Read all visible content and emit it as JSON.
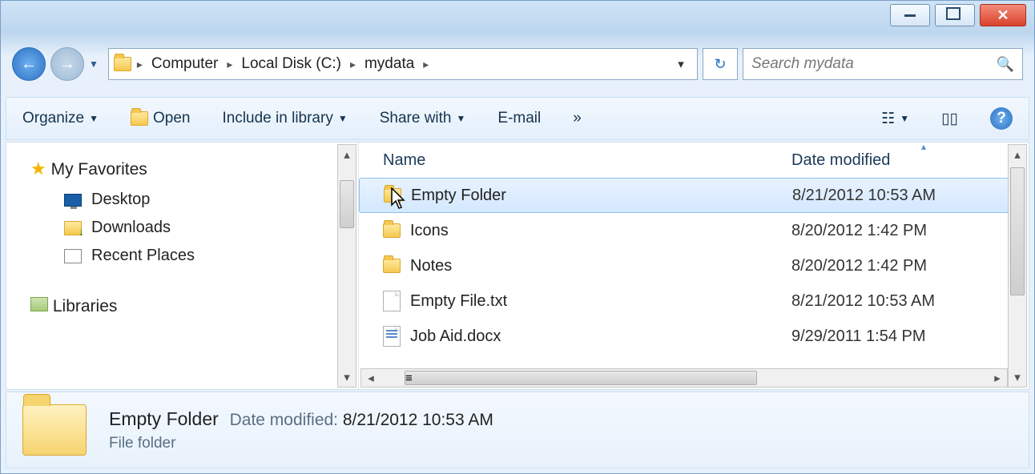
{
  "breadcrumb": {
    "seg1": "Computer",
    "seg2": "Local Disk (C:)",
    "seg3": "mydata"
  },
  "search": {
    "placeholder": "Search mydata"
  },
  "toolbar": {
    "organize": "Organize",
    "open": "Open",
    "include": "Include in library",
    "share": "Share with",
    "email": "E-mail",
    "more": "»"
  },
  "nav": {
    "favorites": "My Favorites",
    "desktop": "Desktop",
    "downloads": "Downloads",
    "recent": "Recent Places",
    "libraries": "Libraries"
  },
  "columns": {
    "name": "Name",
    "date": "Date modified"
  },
  "files": [
    {
      "name": "Empty Folder",
      "date": "8/21/2012 10:53 AM",
      "kind": "folder",
      "selected": true
    },
    {
      "name": "Icons",
      "date": "8/20/2012 1:42 PM",
      "kind": "folder",
      "selected": false
    },
    {
      "name": "Notes",
      "date": "8/20/2012 1:42 PM",
      "kind": "folder",
      "selected": false
    },
    {
      "name": "Empty File.txt",
      "date": "8/21/2012 10:53 AM",
      "kind": "txt",
      "selected": false
    },
    {
      "name": "Job Aid.docx",
      "date": "9/29/2011 1:54 PM",
      "kind": "docx",
      "selected": false,
      "partial": true
    }
  ],
  "details": {
    "title": "Empty Folder",
    "modLabel": "Date modified:",
    "modValue": "8/21/2012 10:53 AM",
    "type": "File folder"
  }
}
